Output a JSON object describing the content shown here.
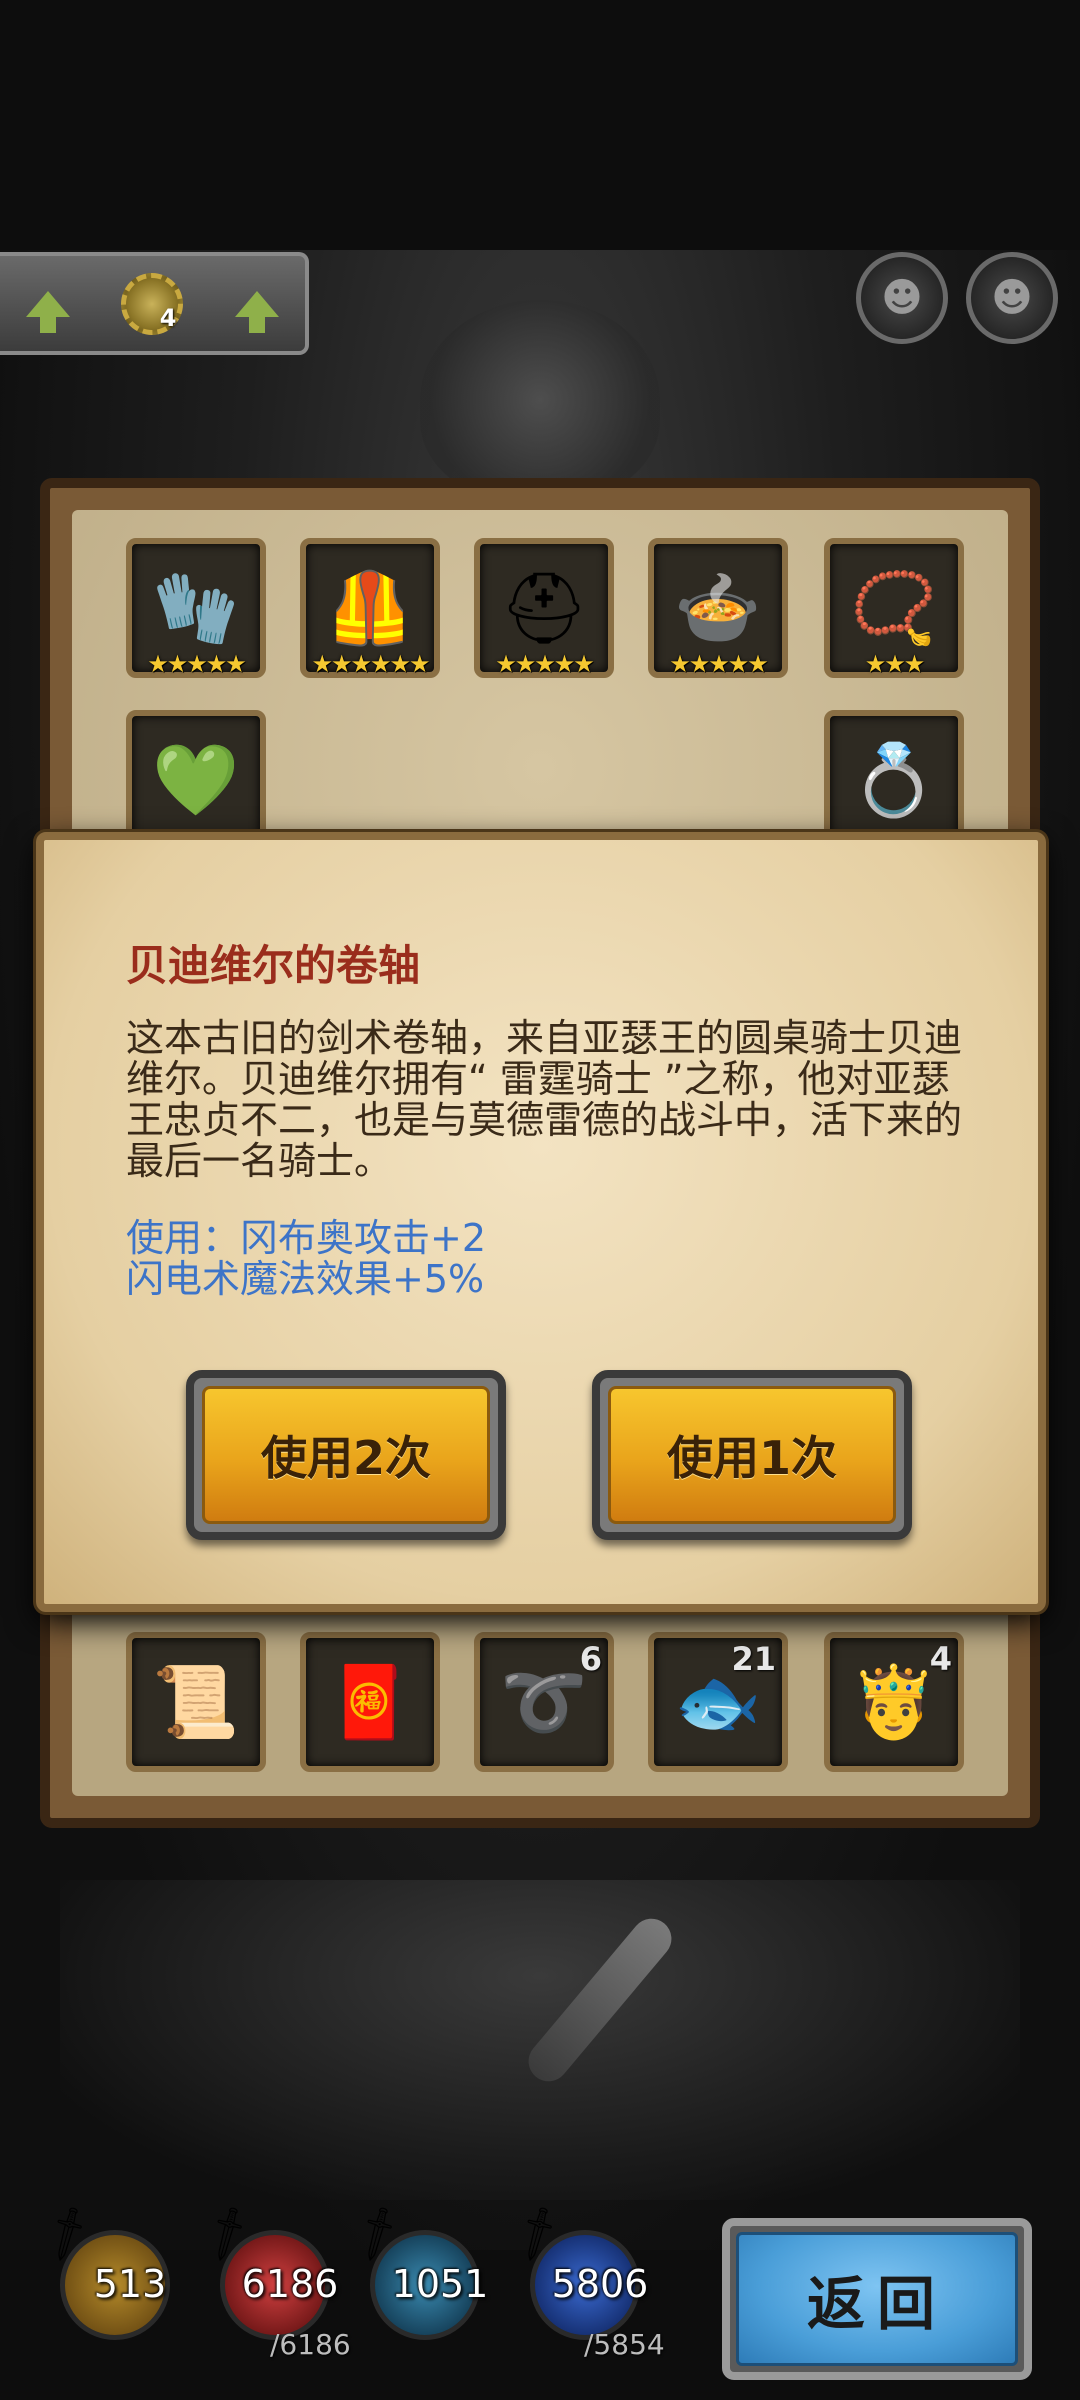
{
  "header": {
    "level_badge": "4"
  },
  "inventory": {
    "equipment_row1": [
      {
        "icon": "bracer-icon",
        "glyph": "🧤",
        "stars": "★★★★★"
      },
      {
        "icon": "armor-icon",
        "glyph": "🦺",
        "stars": "★★★★★★"
      },
      {
        "icon": "helmet-icon",
        "glyph": "⛑",
        "stars": "★★★★★"
      },
      {
        "icon": "pot-icon",
        "glyph": "🍲",
        "stars": "★★★★★"
      },
      {
        "icon": "amulet-icon",
        "glyph": "📿",
        "stars": "★★★"
      }
    ],
    "equipment_row2": [
      {
        "icon": "belt-ring-icon",
        "glyph": "💚"
      },
      {
        "icon": "ring-icon",
        "glyph": "💍"
      }
    ],
    "consumables": [
      {
        "icon": "scroll-icon",
        "glyph": "📜",
        "count": ""
      },
      {
        "icon": "red-scroll-icon",
        "glyph": "🧧",
        "count": ""
      },
      {
        "icon": "whip-icon",
        "glyph": "➰",
        "count": "6"
      },
      {
        "icon": "slime-icon",
        "glyph": "🐟",
        "count": "21"
      },
      {
        "icon": "hero-token-icon",
        "glyph": "🤴",
        "count": "4"
      }
    ]
  },
  "popup": {
    "title": "贝迪维尔的卷轴",
    "description": "这本古旧的剑术卷轴，来自亚瑟王的圆桌骑士贝迪维尔。贝迪维尔拥有“ 雷霆骑士 ”之称，他对亚瑟王忠贞不二，也是与莫德雷德的战斗中，活下来的最后一名骑士。",
    "effect_line1": "使用：冈布奥攻击+2",
    "effect_line2": "闪电术魔法效果+5%",
    "use_twice_label": "使用2次",
    "use_once_label": "使用1次"
  },
  "hud": {
    "attack": "513",
    "hp": "6186",
    "hp_max": "/6186",
    "defense": "1051",
    "mp": "5806",
    "mp_max": "/5854",
    "back_label": "返回"
  },
  "colors": {
    "title_red": "#9a2d1c",
    "effect_blue": "#3d74c8",
    "button_gold": "#e9a41b",
    "back_blue": "#4a9ed8"
  }
}
